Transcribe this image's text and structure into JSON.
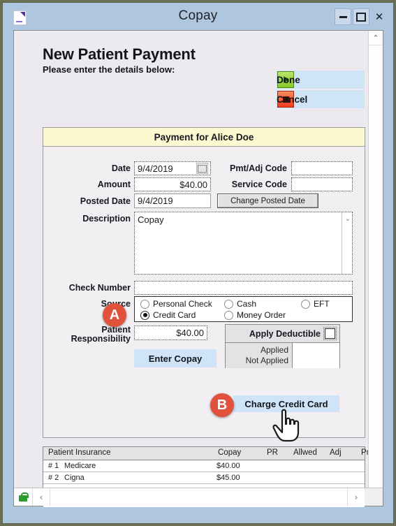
{
  "window": {
    "title": "Copay",
    "icon": "document-icon",
    "minimize_label": "—",
    "maximize_label": "□",
    "close_label": "✕"
  },
  "header": {
    "title": "New Patient Payment",
    "subtitle": "Please enter the details below:",
    "done_label": "Done",
    "cancel_label": "Cancel",
    "done_icon": "green-play-icon",
    "cancel_icon": "red-stop-icon"
  },
  "card": {
    "heading": "Payment for Alice Doe",
    "fields": {
      "date_label": "Date",
      "date_value": "9/4/2019",
      "calendar_icon": "calendar-icon",
      "amount_label": "Amount",
      "amount_value": "$40.00",
      "posted_date_label": "Posted Date",
      "posted_date_value": "9/4/2019",
      "change_posted_date_label": "Change Posted Date",
      "pmt_adj_code_label": "Pmt/Adj Code",
      "pmt_adj_code_value": "",
      "service_code_label": "Service Code",
      "service_code_value": "",
      "description_label": "Description",
      "description_value": "Copay",
      "check_number_label": "Check Number",
      "check_number_value": "",
      "source_label": "Source",
      "patient_responsibility_label_line1": "Patient",
      "patient_responsibility_label_line2": "Responsibility",
      "patient_responsibility_value": "$40.00"
    },
    "source_options": [
      {
        "label": "Personal Check",
        "selected": false
      },
      {
        "label": "Cash",
        "selected": false
      },
      {
        "label": "EFT",
        "selected": false
      },
      {
        "label": "Credit Card",
        "selected": true
      },
      {
        "label": "Money Order",
        "selected": false
      }
    ],
    "enter_copay_label": "Enter Copay",
    "deductible": {
      "apply_label": "Apply Deductible",
      "checked": false,
      "applied_label": "Applied",
      "not_applied_label": "Not Applied",
      "value": ""
    },
    "charge_credit_card_label": "Charge Credit Card"
  },
  "badges": [
    {
      "label": "A",
      "color": "#e1523d"
    },
    {
      "label": "B",
      "color": "#e1523d"
    }
  ],
  "insurance_table": {
    "columns": [
      "Patient Insurance",
      "Copay",
      "PR",
      "Allwed",
      "Adj",
      "Pmt"
    ],
    "rows": [
      {
        "num": "# 1",
        "name": "Medicare",
        "copay": "$40.00",
        "pr": "",
        "allwed": "",
        "adj": "",
        "pmt": ""
      },
      {
        "num": "# 2",
        "name": "Cigna",
        "copay": "$45.00",
        "pr": "",
        "allwed": "",
        "adj": "",
        "pmt": ""
      },
      {
        "num": "",
        "name": "",
        "copay": "",
        "pr": "",
        "allwed": "",
        "adj": "",
        "pmt": ""
      },
      {
        "num": "",
        "name": "",
        "copay": "",
        "pr": "",
        "allwed": "",
        "adj": "",
        "pmt": ""
      }
    ]
  },
  "scrollbars": {
    "vertical_up": "⌃",
    "vertical_down": "⌄",
    "horizontal_left": "‹",
    "horizontal_right": "›",
    "lock_icon": "green-lock-icon"
  }
}
